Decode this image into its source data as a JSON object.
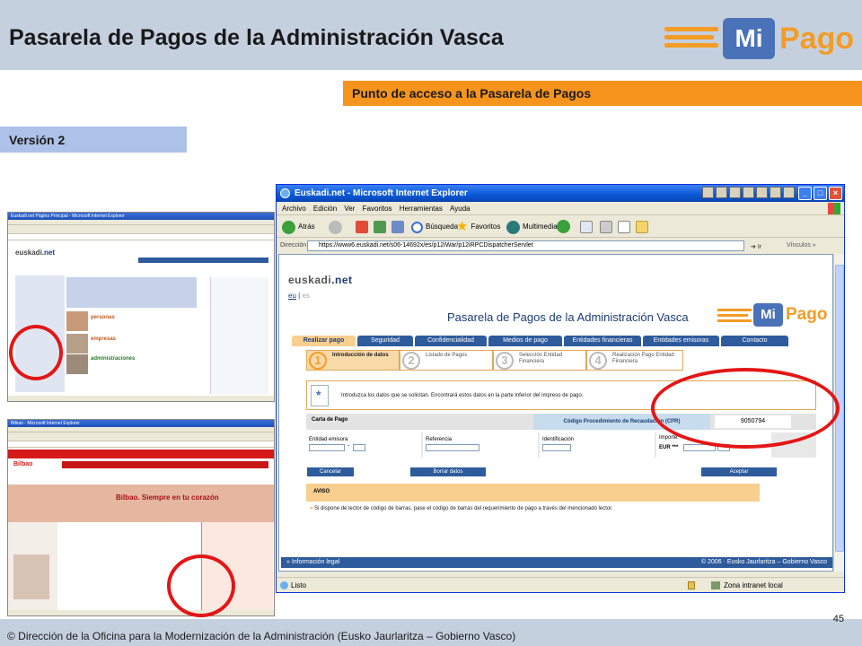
{
  "slide": {
    "title": "Pasarela de Pagos de la Administración Vasca",
    "logo": {
      "mi": "Mi",
      "pago": "Pago"
    },
    "section_label": "Punto de acceso a la Pasarela de Pagos",
    "version_label": "Versión 2",
    "footer": "© Dirección de la Oficina para la Modernización de la Administración (Eusko Jaurlaritza – Gobierno Vasco)",
    "page_number": "45"
  },
  "thumbs": {
    "top_title": "Euskadi.net Página Principal - Microsoft Internet Explorer",
    "bottom_title": "Bilbao - Microsoft Internet Explorer"
  },
  "browser": {
    "title": "Euskadi.net - Microsoft Internet Explorer",
    "menu": [
      "Archivo",
      "Edición",
      "Ver",
      "Favoritos",
      "Herramientas",
      "Ayuda"
    ],
    "toolbar": {
      "back": "Atrás",
      "search": "Búsqueda",
      "favorites": "Favoritos",
      "multimedia": "Multimedia"
    },
    "address_label": "Dirección",
    "url": "https://www6.euskadi.net/s06-14692x/es/p12iWar/p12iRPCDispatcherServlet",
    "go": "Ir",
    "links": "Vínculos",
    "status": "Listo",
    "zone": "Zona intranet local"
  },
  "page": {
    "brand_prefix": "euskadi",
    "brand_suffix": ".net",
    "lang_active": "eu",
    "lang_inactive": "es",
    "heading": "Pasarela de Pagos de la Administración Vasca",
    "tabs": [
      "Realizar pago",
      "Seguridad",
      "Confidencialidad",
      "Medios de pago",
      "Entidades financieras",
      "Entidades emisoras",
      "Contacto"
    ],
    "steps": [
      {
        "num": "1",
        "label": "Introducción de datos"
      },
      {
        "num": "2",
        "label": "Listado de Pagos"
      },
      {
        "num": "3",
        "label": "Selección Entidad Financiera"
      },
      {
        "num": "4",
        "label": "Realización Pago Entidad Financiera"
      }
    ],
    "info_text": "Introduzca los datos que se solicitan. Encontrará estos datos en la parte inferior del impreso de pago.",
    "card_label": "Carta de Pago",
    "cpr_label": "Código Procedimiento de Recaudación (CPR)",
    "cpr_value": "9050794",
    "fields": {
      "issuer": "Entidad emisora",
      "reference": "Referencia",
      "identification": "Identificación",
      "amount": "Importe",
      "currency": "EUR",
      "stars": "***",
      "dash": "-"
    },
    "buttons": {
      "cancel": "Cancelar",
      "clear": "Borrar datos",
      "accept": "Aceptar"
    },
    "notice_title": "AVISO",
    "notice_text": "Si dispone de lector de código de barras, pase el código de barras del requerimiento de pago a través del mencionado lector.",
    "legal": "» Información legal",
    "copyright": "© 2006 · Eusko Jaurlaritza – Gobierno Vasco"
  }
}
